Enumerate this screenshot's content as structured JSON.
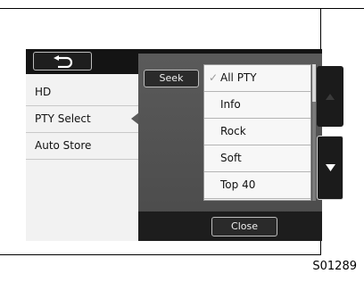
{
  "figure_code": "S01289",
  "header": {
    "back_icon": "return-arrow-icon"
  },
  "menu": {
    "items": [
      {
        "label": "HD"
      },
      {
        "label": "PTY Select"
      },
      {
        "label": "Auto Store"
      }
    ]
  },
  "panel": {
    "seek_label": "Seek",
    "selected_check": "✓",
    "options": [
      {
        "label": "All PTY",
        "selected": true
      },
      {
        "label": "Info"
      },
      {
        "label": "Rock"
      },
      {
        "label": "Soft"
      },
      {
        "label": "Top 40"
      }
    ],
    "scroll_up_icon": "triangle-up-icon",
    "scroll_down_icon": "triangle-down-icon",
    "close_label": "Close"
  }
}
